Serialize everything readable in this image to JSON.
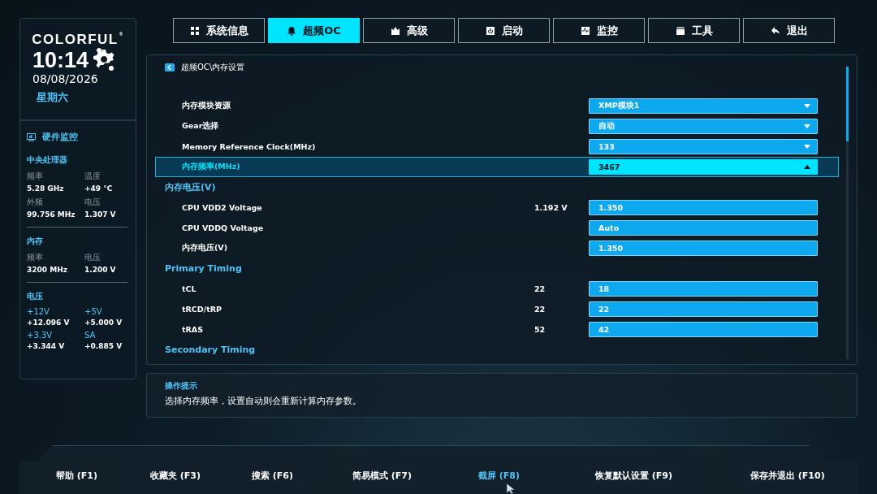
{
  "brand": {
    "logo": "COLORFUL",
    "mark": "®",
    "time": "10:14",
    "date": "08/08/2026",
    "weekday": "星期六"
  },
  "monitor": {
    "title": "硬件监控",
    "groups": [
      {
        "title": "中央处理器",
        "kind": "stats",
        "items": [
          {
            "label": "频率",
            "value": "5.28 GHz"
          },
          {
            "label": "温度",
            "value": "+49 °C"
          },
          {
            "label": "外频",
            "value": "99.756 MHz"
          },
          {
            "label": "电压",
            "value": "1.307 V"
          }
        ]
      },
      {
        "title": "内存",
        "kind": "stats",
        "items": [
          {
            "label": "频率",
            "value": "3200 MHz"
          },
          {
            "label": "电压",
            "value": "1.200 V"
          }
        ]
      },
      {
        "title": "电压",
        "kind": "rails",
        "items": [
          {
            "label": "+12V",
            "value": "+12.096 V"
          },
          {
            "label": "+5V",
            "value": "+5.000 V"
          },
          {
            "label": "+3.3V",
            "value": "+3.344 V"
          },
          {
            "label": "SA",
            "value": "+0.885 V"
          }
        ]
      }
    ]
  },
  "tabs": [
    {
      "label": "系统信息",
      "selected": false
    },
    {
      "label": "超频OC",
      "selected": true
    },
    {
      "label": "高级",
      "selected": false
    },
    {
      "label": "启动",
      "selected": false
    },
    {
      "label": "监控",
      "selected": false
    },
    {
      "label": "工具",
      "selected": false
    },
    {
      "label": "退出",
      "selected": false
    }
  ],
  "breadcrumb": "超频OC\\内存设置",
  "settings": [
    {
      "kind": "dropdown",
      "label": "内存模块资源",
      "value": "XMP模块1",
      "expanded": false,
      "selected": false
    },
    {
      "kind": "dropdown",
      "label": "Gear选择",
      "value": "自动",
      "expanded": false,
      "selected": false
    },
    {
      "kind": "dropdown",
      "label": "Memory Reference Clock(MHz)",
      "value": "133",
      "expanded": false,
      "selected": false
    },
    {
      "kind": "dropdown",
      "label": "内存频率(MHz)",
      "value": "3467",
      "expanded": true,
      "selected": true
    },
    {
      "kind": "header",
      "label": "内存电压(V)"
    },
    {
      "kind": "input",
      "label": "CPU VDD2 Voltage",
      "reading": "1.192 V",
      "value": "1.350",
      "selected": false
    },
    {
      "kind": "input",
      "label": "CPU VDDQ Voltage",
      "value": "Auto",
      "selected": false
    },
    {
      "kind": "input",
      "label": "内存电压(V)",
      "value": "1.350",
      "selected": false
    },
    {
      "kind": "header",
      "label": "Primary Timing"
    },
    {
      "kind": "input",
      "label": "tCL",
      "reading": "22",
      "value": "18",
      "selected": false
    },
    {
      "kind": "input",
      "label": "tRCD/tRP",
      "reading": "22",
      "value": "22",
      "selected": false
    },
    {
      "kind": "input",
      "label": "tRAS",
      "reading": "52",
      "value": "42",
      "selected": false
    },
    {
      "kind": "header",
      "label": "Secondary Timing"
    }
  ],
  "hint": {
    "title": "操作提示",
    "text": "选择内存频率，设置自动则会重新计算内存参数。"
  },
  "footer": [
    {
      "label": "帮助 (F1)",
      "selected": false
    },
    {
      "label": "收藏夹 (F3)",
      "selected": false
    },
    {
      "label": "搜索 (F6)",
      "selected": false
    },
    {
      "label": "简易模式 (F7)",
      "selected": false
    },
    {
      "label": "截屏 (F8)",
      "selected": true
    },
    {
      "label": "恢复默认设置 (F9)",
      "selected": false
    },
    {
      "label": "保存并退出 (F10)",
      "selected": false
    }
  ]
}
